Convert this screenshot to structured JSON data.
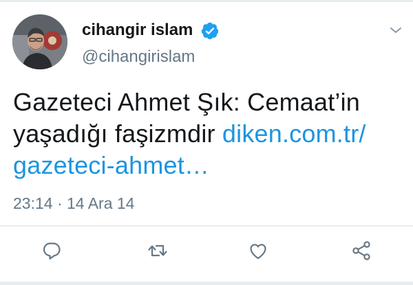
{
  "tweet": {
    "author": {
      "display_name": "cihangir islam",
      "handle": "@cihangirislam",
      "verified": true,
      "avatar_icon": "profile-photo"
    },
    "text_plain": "Gazeteci Ahmet Şık: Cemaat’in yaşadığı faşizmdir ",
    "link_text": "diken.com.tr/ gazeteci-ahmet…",
    "timestamp": "23:14 · 14 Ara 14",
    "menu_icon": "chevron-down-icon",
    "actions": [
      {
        "name": "reply",
        "icon": "reply-icon"
      },
      {
        "name": "retweet",
        "icon": "retweet-icon"
      },
      {
        "name": "like",
        "icon": "heart-icon"
      },
      {
        "name": "share",
        "icon": "share-icon"
      }
    ]
  },
  "colors": {
    "text": "#14171a",
    "muted": "#657786",
    "link": "#1b95e0",
    "verified": "#1da1f2",
    "divider": "#e6ecf0",
    "action_icon": "#657786"
  }
}
